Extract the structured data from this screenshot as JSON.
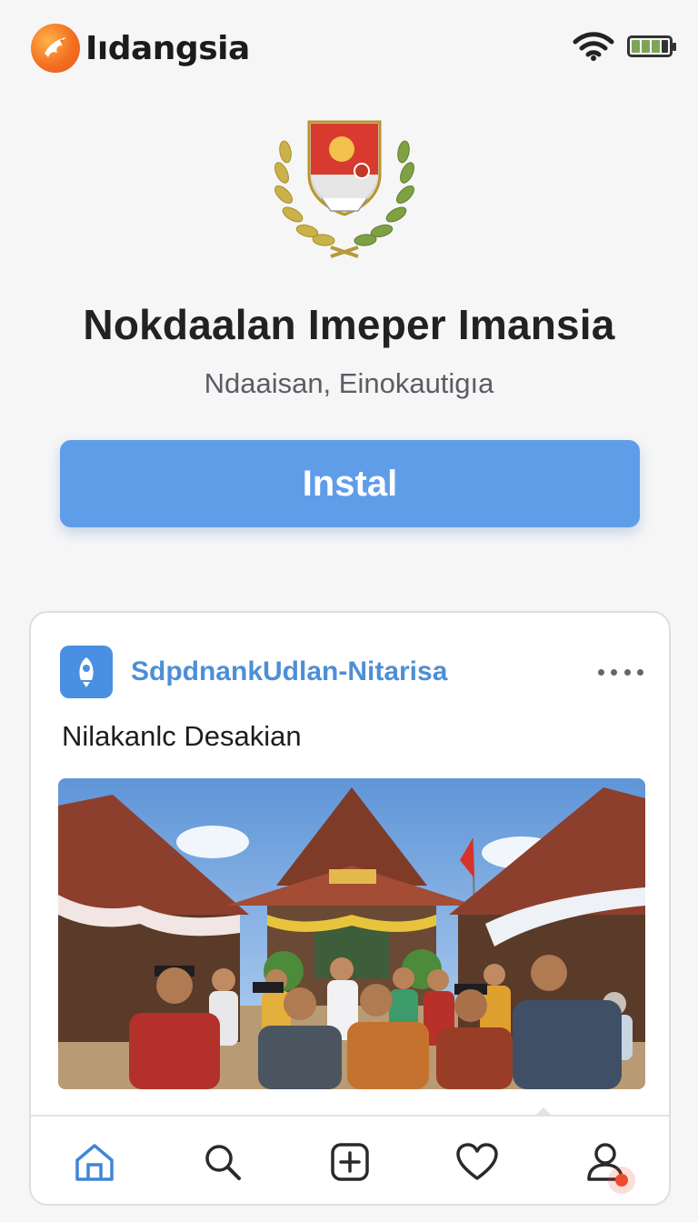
{
  "header": {
    "brand_name": "Iıdangsia",
    "brand_logo_icon": "phoenix-logo-icon",
    "status_icons": [
      "wifi-icon",
      "battery-icon"
    ]
  },
  "app": {
    "emblem_icon": "national-emblem-icon",
    "title": "Nokdaalan Imeper Imansia",
    "subtitle": "Ndaaisan, Einokautigıa",
    "install_label": "Instal"
  },
  "post": {
    "author_icon": "rocket-icon",
    "author": "SdpdnankUdlan-Nitarisa",
    "caption": "Nilakanlc Desakian",
    "image_icon": "village-gathering-photo",
    "more_icon": "more-dots-icon"
  },
  "nav": {
    "items": [
      "home-icon",
      "search-icon",
      "add-icon",
      "heart-icon",
      "profile-icon"
    ],
    "active": "home-icon"
  },
  "colors": {
    "accent": "#5f9de8",
    "author_link": "#4d8fd6",
    "active_nav": "#3f87d6",
    "notification": "#f04a2c",
    "brand_orange": "#f37021"
  }
}
